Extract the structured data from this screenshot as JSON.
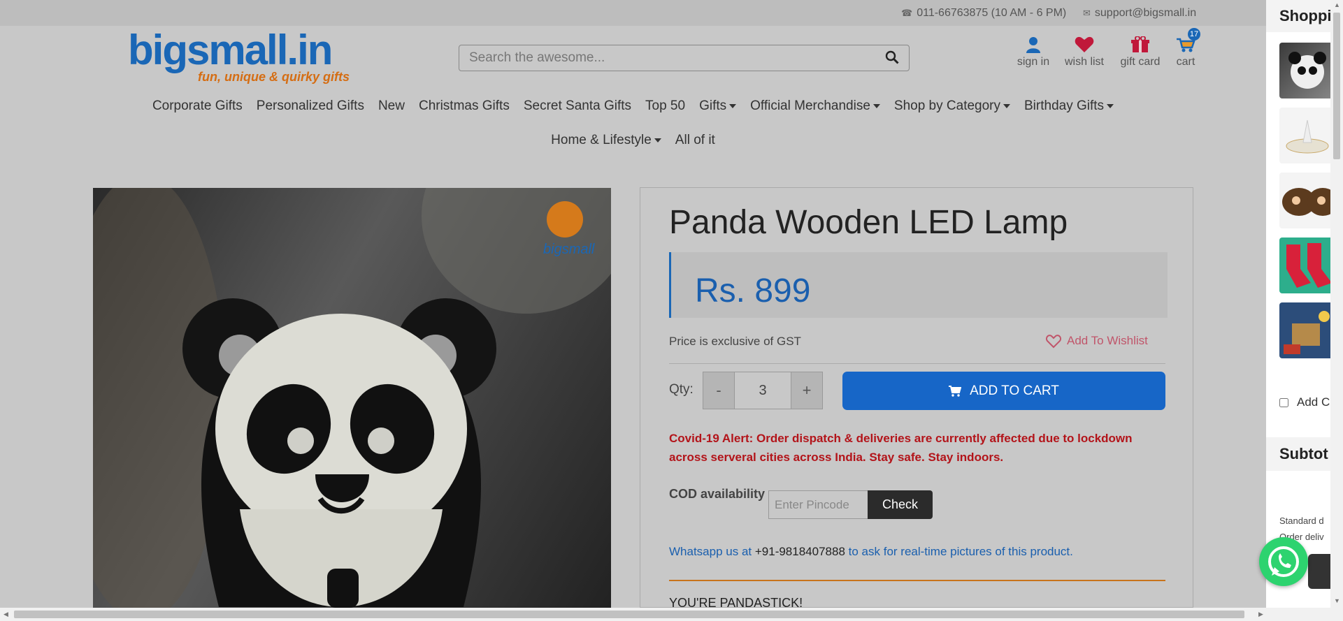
{
  "topbar": {
    "phone": "011-66763875 (10 AM - 6 PM)",
    "email": "support@bigsmall.in"
  },
  "logo": {
    "main": "bigsmall.in",
    "tagline": "fun, unique & quirky gifts"
  },
  "search": {
    "placeholder": "Search the awesome..."
  },
  "header_icons": {
    "signin": "sign in",
    "wishlist": "wish list",
    "giftcard": "gift card",
    "cart": "cart",
    "cart_count": "17"
  },
  "nav": {
    "row1": [
      {
        "label": "Corporate Gifts",
        "dropdown": false
      },
      {
        "label": "Personalized Gifts",
        "dropdown": false
      },
      {
        "label": "New",
        "dropdown": false
      },
      {
        "label": "Christmas Gifts",
        "dropdown": false
      },
      {
        "label": "Secret Santa Gifts",
        "dropdown": false
      },
      {
        "label": "Top 50",
        "dropdown": false
      },
      {
        "label": "Gifts",
        "dropdown": true
      },
      {
        "label": "Official Merchandise",
        "dropdown": true
      },
      {
        "label": "Shop by Category",
        "dropdown": true
      },
      {
        "label": "Birthday Gifts",
        "dropdown": true
      }
    ],
    "row2": [
      {
        "label": "Home & Lifestyle",
        "dropdown": true
      },
      {
        "label": "All of it",
        "dropdown": false
      }
    ]
  },
  "product": {
    "title": "Panda Wooden LED Lamp",
    "price": "Rs. 899",
    "gst_note": "Price is exclusive of GST",
    "wishlist_label": "Add To Wishlist",
    "qty_label": "Qty:",
    "qty_minus": "-",
    "qty_value": "3",
    "qty_plus": "+",
    "add_to_cart": "ADD TO CART",
    "covid_alert": "Covid-19 Alert: Order dispatch & deliveries are currently affected due to lockdown across serveral cities across India. Stay safe. Stay indoors.",
    "cod_label": "COD availability",
    "pincode_placeholder": "Enter Pincode",
    "check_label": "Check",
    "whatsapp_prefix": "Whatsapp us at",
    "whatsapp_number": "+91-9818407888",
    "whatsapp_suffix": "to ask for real-time pictures of this product.",
    "tagline": "YOU'RE PANDASTICK!"
  },
  "side_cart": {
    "heading": "Shoppi",
    "add_checkbox_label": "Add C",
    "subtotal_heading": "Subtot",
    "standard_text": "Standard d",
    "order_text": "Order deliv"
  },
  "colors": {
    "brand_blue": "#1a67b6",
    "brand_orange": "#d56d13",
    "add_to_cart_bg": "#1766c7",
    "alert_red": "#b3141a",
    "whatsapp_green": "#2dd36f"
  }
}
